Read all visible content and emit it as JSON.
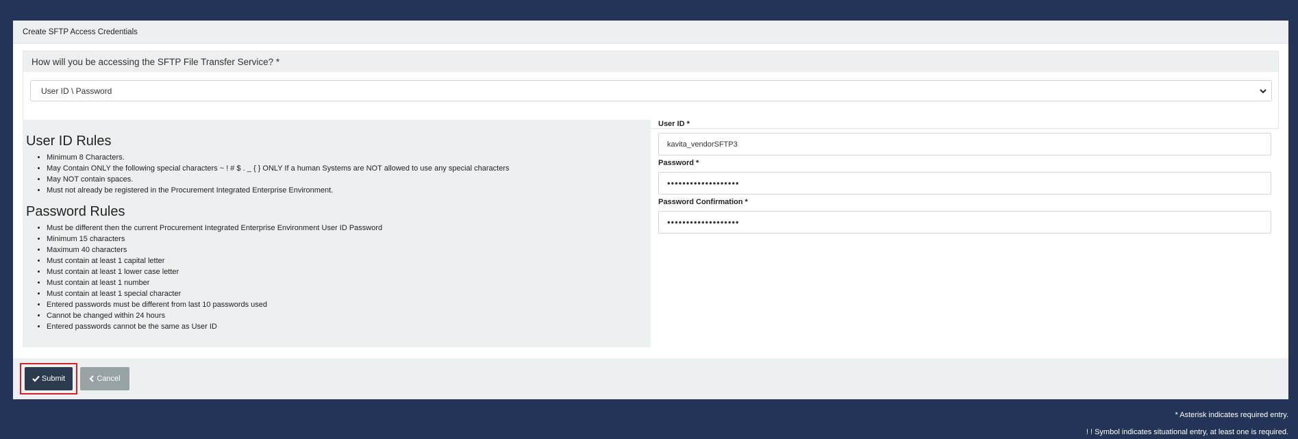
{
  "panel": {
    "title": "Create SFTP Access Credentials"
  },
  "question": {
    "label": "How will you be accessing the SFTP File Transfer Service? *",
    "selected": "User ID \\ Password"
  },
  "userid_rules": {
    "title": "User ID Rules",
    "items": [
      "Minimum 8 Characters.",
      "May Contain ONLY the following special characters ~ ! # $ . _ { } ONLY If a human Systems are NOT allowed to use any special characters",
      "May NOT contain spaces.",
      "Must not already be registered in the Procurement Integrated Enterprise Environment."
    ]
  },
  "password_rules": {
    "title": "Password Rules",
    "items": [
      "Must be different then the current Procurement Integrated Enterprise Environment User ID Password",
      "Minimum 15 characters",
      "Maximum 40 characters",
      "Must contain at least 1 capital letter",
      "Must contain at least 1 lower case letter",
      "Must contain at least 1 number",
      "Must contain at least 1 special character",
      "Entered passwords must be different from last 10 passwords used",
      "Cannot be changed within 24 hours",
      "Entered passwords cannot be the same as User ID"
    ]
  },
  "form": {
    "userid_label": "User ID *",
    "userid_value": "kavita_vendorSFTP3",
    "password_label": "Password *",
    "password_value": "•••••••••••••••••••",
    "confirm_label": "Password Confirmation *",
    "confirm_value": "•••••••••••••••••••"
  },
  "buttons": {
    "submit": "Submit",
    "cancel": "Cancel"
  },
  "notes": {
    "required": "* Asterisk indicates required entry.",
    "situational": "! ! Symbol indicates situational entry, at least one is required."
  },
  "icons": {
    "submit": "check-icon",
    "cancel": "chevron-left-icon",
    "select": "chevron-down-icon"
  },
  "colors": {
    "background": "#233457",
    "submit": "#2b3a4c",
    "cancel": "#98a3a5",
    "highlight": "#d21f28"
  }
}
